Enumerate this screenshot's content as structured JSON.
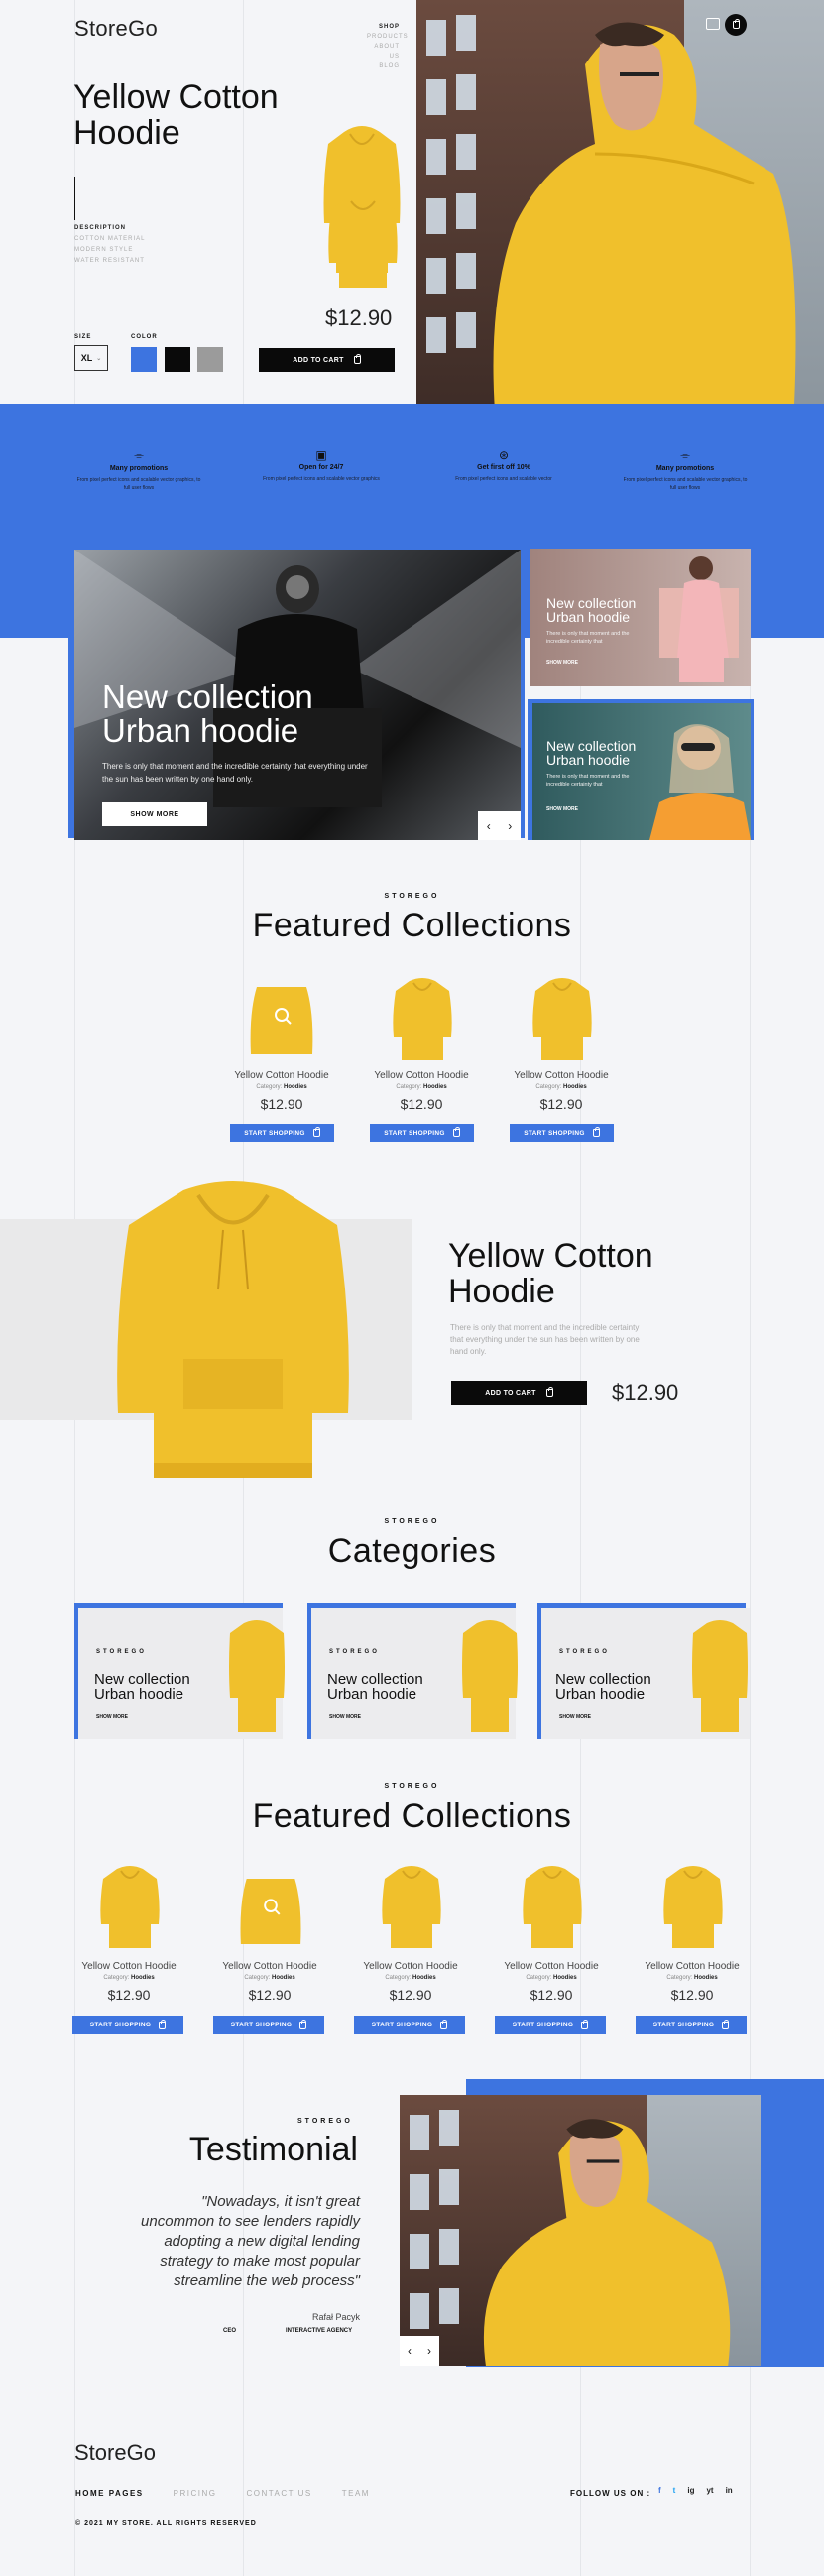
{
  "brand": "StoreGo",
  "nav": {
    "items": [
      "SHOP",
      "PRODUCTS",
      "ABOUT US",
      "BLOG"
    ]
  },
  "hero": {
    "title_line1": "Yellow Cotton",
    "title_line2": "Hoodie",
    "desc_label": "DESCRIPTION",
    "desc_items": [
      "COTTON MATERIAL",
      "MODERN STYLE",
      "WATER RESISTANT"
    ],
    "price": "$12.90",
    "size_label": "SIZE",
    "size_value": "XL",
    "color_label": "COLOR",
    "colors": [
      "#3d74e0",
      "#0a0a0a",
      "#9b9b9b"
    ],
    "cart_label": "ADD TO CART"
  },
  "features": [
    {
      "icon": "tag-icon",
      "title": "Many promotions",
      "text": "From pixel perfect icons and scalable vector graphics, to full user flows"
    },
    {
      "icon": "gift-icon",
      "title": "Open for 24/7",
      "text": "From pixel perfect icons and scalable vector graphics"
    },
    {
      "icon": "percent-icon",
      "title": "Get first off 10%",
      "text": "From pixel perfect icons and scalable vector"
    },
    {
      "icon": "tag-icon",
      "title": "Many promotions",
      "text": "From pixel perfect icons and scalable vector graphics, to full user flows"
    }
  ],
  "banner": {
    "title_line1": "New collection",
    "title_line2": "Urban hoodie",
    "text": "There is only that moment and the incredible certainty that everything under the sun has been written by one hand only.",
    "button": "SHOW MORE",
    "prev": "‹",
    "next": "›"
  },
  "side_banners": [
    {
      "title_line1": "New collection",
      "title_line2": "Urban hoodie",
      "text": "There is only that moment and the incredible certainty that",
      "link": "SHOW MORE"
    },
    {
      "title_line1": "New collection",
      "title_line2": "Urban hoodie",
      "text": "There is only that moment and the incredible certainty that",
      "link": "SHOW MORE"
    }
  ],
  "featured1": {
    "kicker": "STOREGO",
    "title": "Featured Collections",
    "products": [
      {
        "name": "Yellow Cotton Hoodie",
        "cat_label": "Category:",
        "cat": "Hoodies",
        "price": "$12.90",
        "btn": "START SHOPPING"
      },
      {
        "name": "Yellow Cotton Hoodie",
        "cat_label": "Category:",
        "cat": "Hoodies",
        "price": "$12.90",
        "btn": "START SHOPPING"
      },
      {
        "name": "Yellow Cotton Hoodie",
        "cat_label": "Category:",
        "cat": "Hoodies",
        "price": "$12.90",
        "btn": "START SHOPPING"
      }
    ]
  },
  "spotlight": {
    "title_line1": "Yellow Cotton",
    "title_line2": "Hoodie",
    "text": "There is only that moment and the incredible certainty that everything under the sun has been written by one hand only.",
    "cart_label": "ADD TO CART",
    "price": "$12.90"
  },
  "categories": {
    "kicker": "STOREGO",
    "title": "Categories",
    "cards": [
      {
        "kicker": "STOREGO",
        "title_line1": "New collection",
        "title_line2": "Urban hoodie",
        "link": "SHOW MORE"
      },
      {
        "kicker": "STOREGO",
        "title_line1": "New collection",
        "title_line2": "Urban hoodie",
        "link": "SHOW MORE"
      },
      {
        "kicker": "STOREGO",
        "title_line1": "New collection",
        "title_line2": "Urban hoodie",
        "link": "SHOW MORE"
      }
    ]
  },
  "featured2": {
    "kicker": "STOREGO",
    "title": "Featured Collections",
    "products": [
      {
        "name": "Yellow Cotton Hoodie",
        "cat_label": "Category:",
        "cat": "Hoodies",
        "price": "$12.90",
        "btn": "START SHOPPING"
      },
      {
        "name": "Yellow Cotton Hoodie",
        "cat_label": "Category:",
        "cat": "Hoodies",
        "price": "$12.90",
        "btn": "START SHOPPING"
      },
      {
        "name": "Yellow Cotton Hoodie",
        "cat_label": "Category:",
        "cat": "Hoodies",
        "price": "$12.90",
        "btn": "START SHOPPING"
      },
      {
        "name": "Yellow Cotton Hoodie",
        "cat_label": "Category:",
        "cat": "Hoodies",
        "price": "$12.90",
        "btn": "START SHOPPING"
      },
      {
        "name": "Yellow Cotton Hoodie",
        "cat_label": "Category:",
        "cat": "Hoodies",
        "price": "$12.90",
        "btn": "START SHOPPING"
      }
    ]
  },
  "testimonial": {
    "kicker": "STOREGO",
    "title": "Testimonial",
    "quote_l1": "\"Nowadays, it isn't great",
    "quote_l2": "uncommon to see lenders rapidly",
    "quote_l3": "adopting a new digital lending",
    "quote_l4": "strategy to make most  popular",
    "quote_l5": "streamline the web process\"",
    "author": "Rafał Pacyk",
    "role": "CEO",
    "company": "INTERACTIVE AGENCY",
    "prev": "‹",
    "next": "›"
  },
  "footer": {
    "brand": "StoreGo",
    "links": [
      "HOME PAGES",
      "PRICING",
      "CONTACT US",
      "TEAM"
    ],
    "follow": "FOLLOW US ON :",
    "social": [
      "f",
      "t",
      "ig",
      "yt",
      "in"
    ],
    "copyright": "© 2021 MY STORE. ALL RIGHTS RESERVED"
  },
  "colors": {
    "accent": "#3d74e0",
    "hoodie": "#f0c02c",
    "dark": "#0a0a0a"
  }
}
